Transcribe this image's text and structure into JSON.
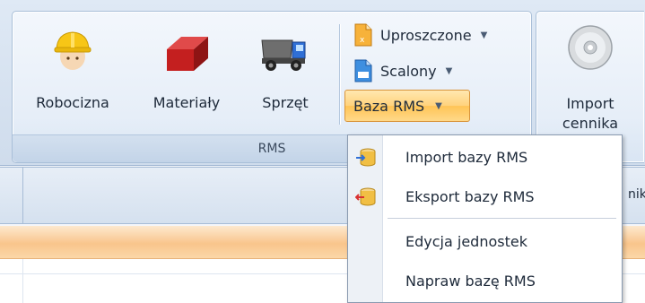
{
  "ribbon": {
    "rms_group": {
      "label": "RMS",
      "robocizna": "Robocizna",
      "materialy": "Materiały",
      "sprzet": "Sprzęt",
      "uproszczone": "Uproszczone",
      "scalony": "Scalony",
      "baza_rms": "Baza RMS"
    },
    "import_group": {
      "label_line1": "Import",
      "label_line2": "cennika"
    }
  },
  "grid": {
    "header_partial_text": "nik"
  },
  "menu": {
    "items": [
      {
        "label": "Import bazy RMS",
        "icon": "db-import-icon"
      },
      {
        "label": "Eksport bazy RMS",
        "icon": "db-export-icon"
      },
      {
        "label": "Edycja jednostek"
      },
      {
        "label": "Napraw bazę RMS"
      }
    ]
  },
  "colors": {
    "ribbon_bg": "#dfe9f5",
    "active_button": "#ffd27c",
    "orange_band": "#f9c58c"
  }
}
